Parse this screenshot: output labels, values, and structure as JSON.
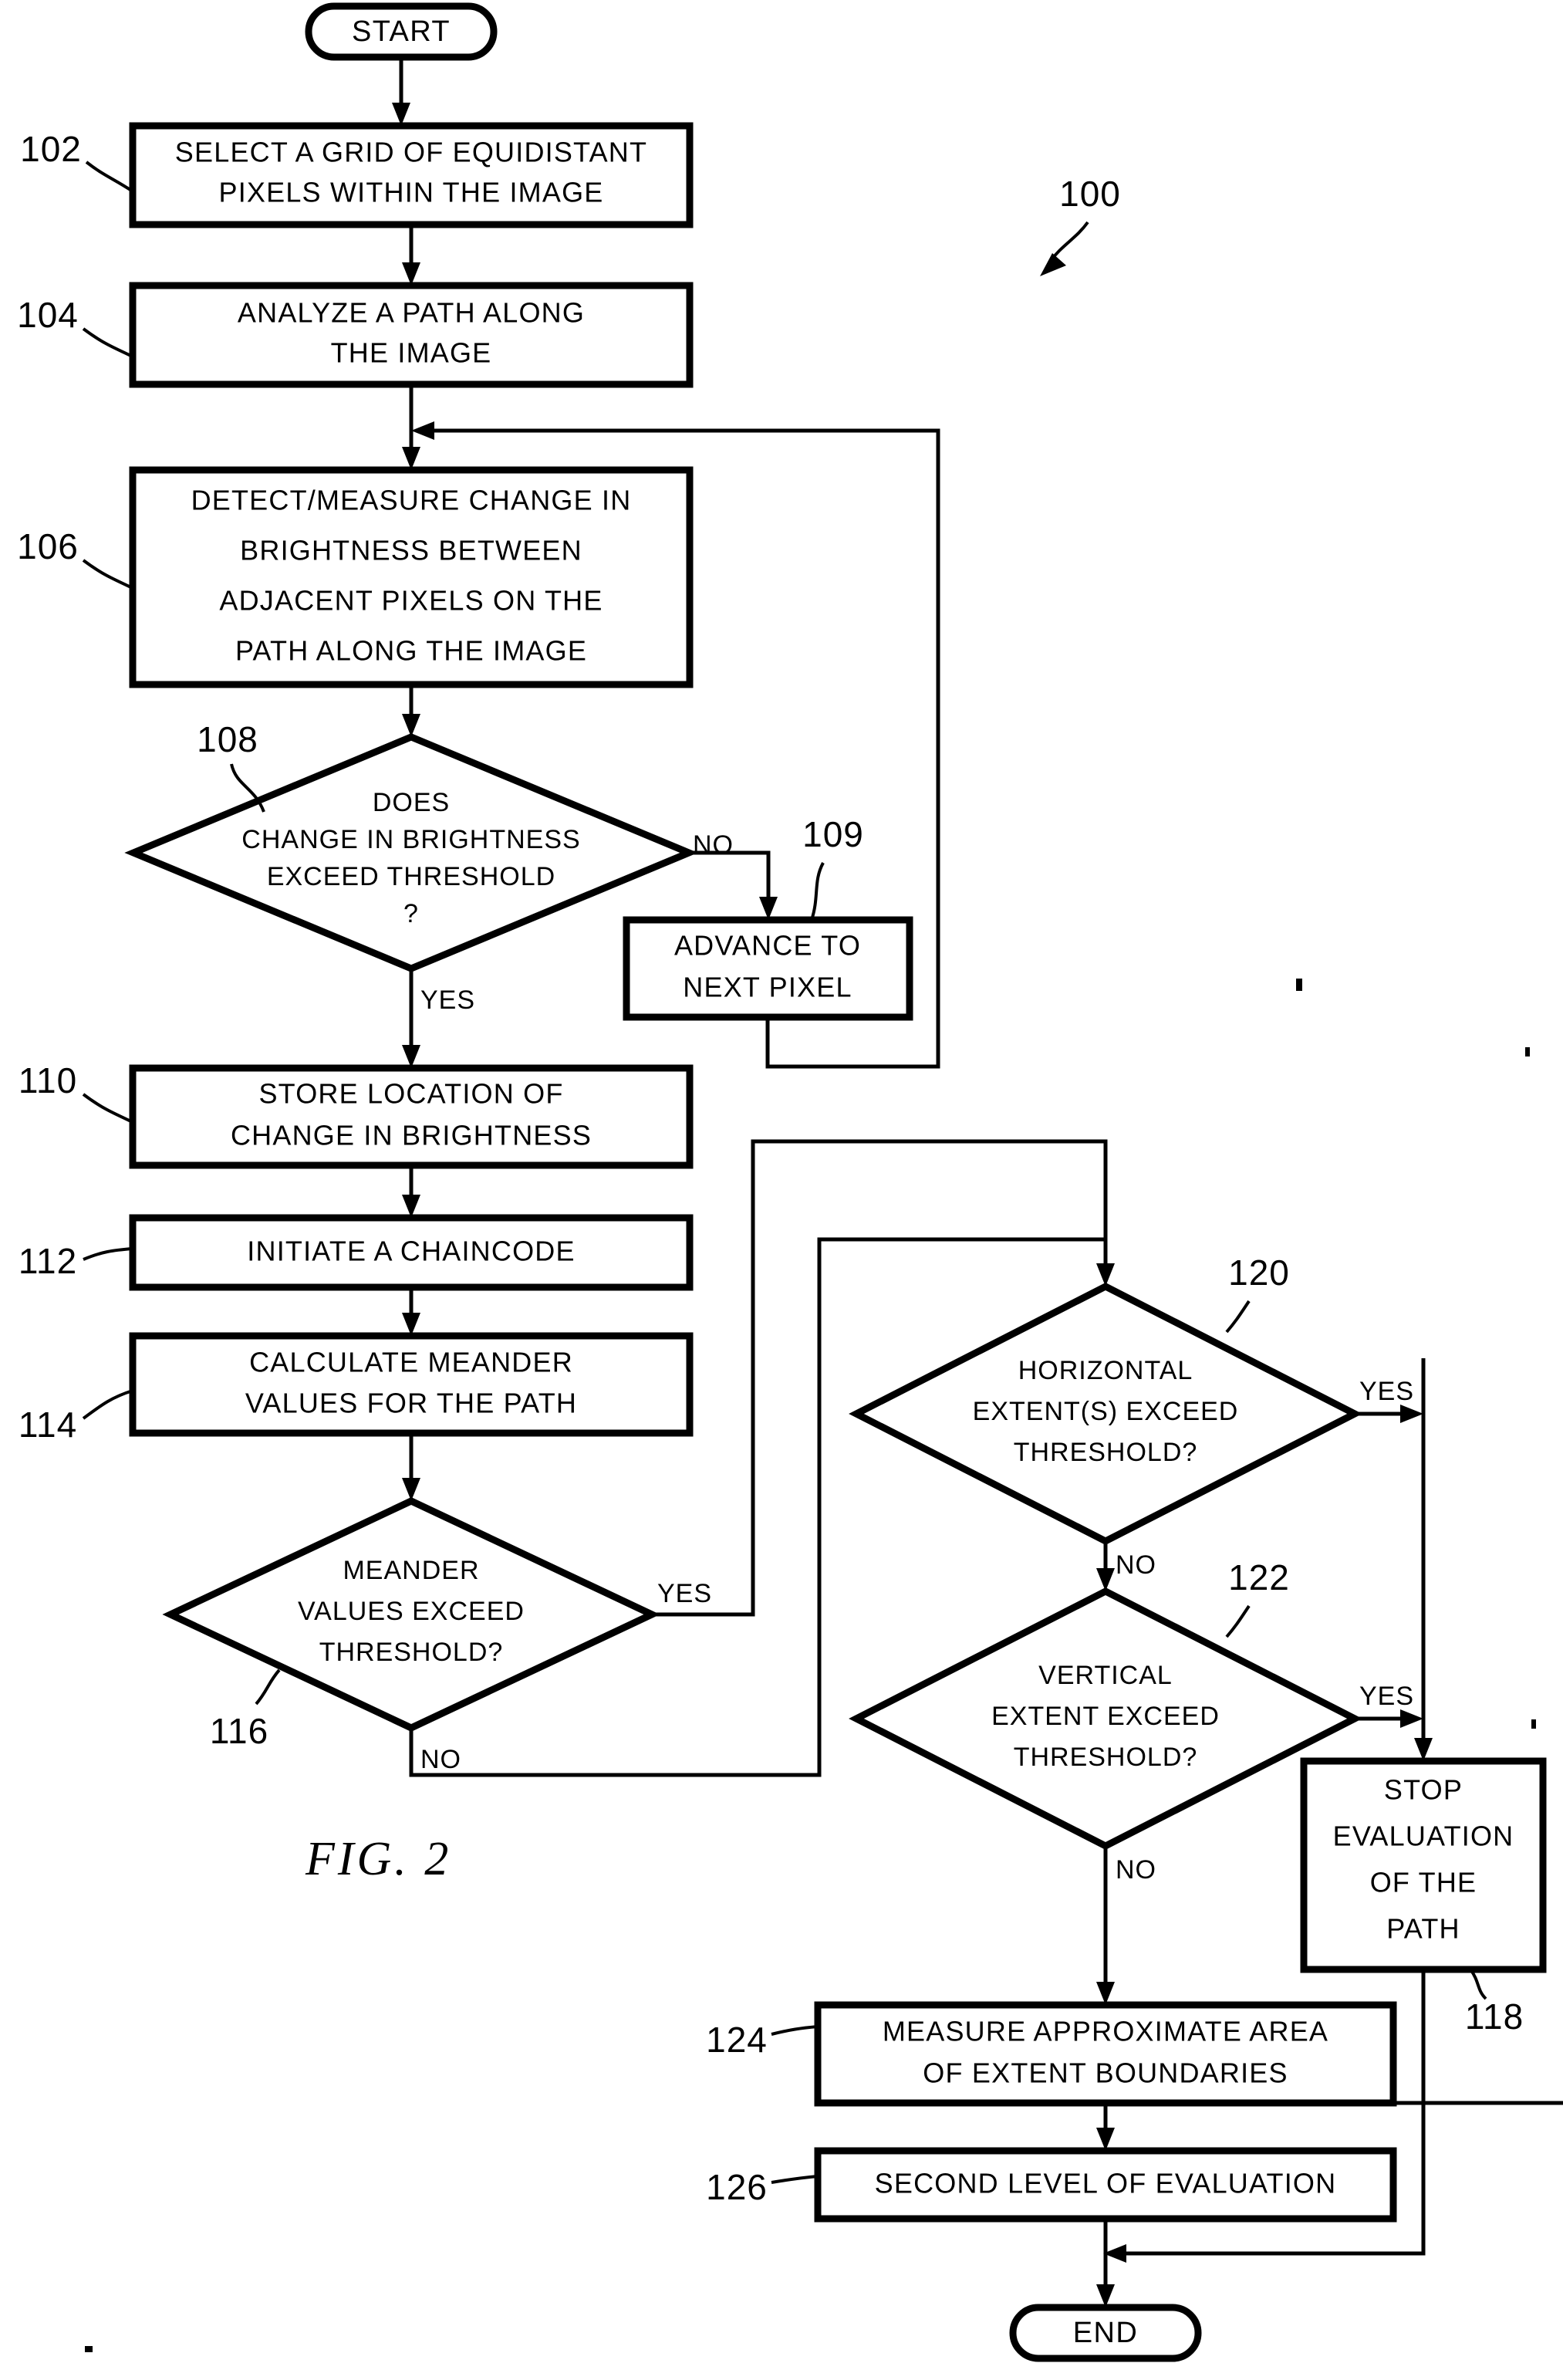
{
  "figure": {
    "caption": "FIG.  2",
    "system_ref": "100"
  },
  "terminals": {
    "start": "START",
    "end": "END"
  },
  "process_blocks": [
    {
      "ref": "102",
      "lines": [
        "SELECT A GRID OF EQUIDISTANT",
        "PIXELS WITHIN THE IMAGE"
      ]
    },
    {
      "ref": "104",
      "lines": [
        "ANALYZE A PATH ALONG",
        "THE IMAGE"
      ]
    },
    {
      "ref": "106",
      "lines": [
        "DETECT/MEASURE CHANGE IN",
        "BRIGHTNESS BETWEEN",
        "ADJACENT PIXELS ON THE",
        "PATH ALONG THE IMAGE"
      ]
    },
    {
      "ref": "109",
      "lines": [
        "ADVANCE TO",
        "NEXT PIXEL"
      ]
    },
    {
      "ref": "110",
      "lines": [
        "STORE LOCATION OF",
        "CHANGE IN BRIGHTNESS"
      ]
    },
    {
      "ref": "112",
      "lines": [
        "INITIATE A CHAINCODE"
      ]
    },
    {
      "ref": "114",
      "lines": [
        "CALCULATE MEANDER",
        "VALUES FOR THE PATH"
      ]
    },
    {
      "ref": "118",
      "lines": [
        "STOP",
        "EVALUATION",
        "OF THE",
        "PATH"
      ]
    },
    {
      "ref": "124",
      "lines": [
        "MEASURE APPROXIMATE AREA",
        "OF EXTENT BOUNDARIES"
      ]
    },
    {
      "ref": "126",
      "lines": [
        "SECOND LEVEL OF EVALUATION"
      ]
    }
  ],
  "decisions": [
    {
      "ref": "108",
      "lines": [
        "DOES",
        "CHANGE IN BRIGHTNESS",
        "EXCEED THRESHOLD",
        "?"
      ],
      "yes": "YES",
      "no": "NO"
    },
    {
      "ref": "116",
      "lines": [
        "MEANDER",
        "VALUES EXCEED",
        "THRESHOLD?"
      ],
      "yes": "YES",
      "no": "NO"
    },
    {
      "ref": "120",
      "lines": [
        "HORIZONTAL",
        "EXTENT(S) EXCEED",
        "THRESHOLD?"
      ],
      "yes": "YES",
      "no": "NO"
    },
    {
      "ref": "122",
      "lines": [
        "VERTICAL",
        "EXTENT EXCEED",
        "THRESHOLD?"
      ],
      "yes": "YES",
      "no": "NO"
    }
  ],
  "branch_labels": {
    "d108_no": "NO",
    "d108_yes": "YES",
    "d116_yes": "YES",
    "d116_no": "NO",
    "d120_yes": "YES",
    "d120_no": "NO",
    "d122_yes": "YES",
    "d122_no": "NO"
  },
  "colors": {
    "ink": "#000000",
    "paper": "#ffffff"
  }
}
